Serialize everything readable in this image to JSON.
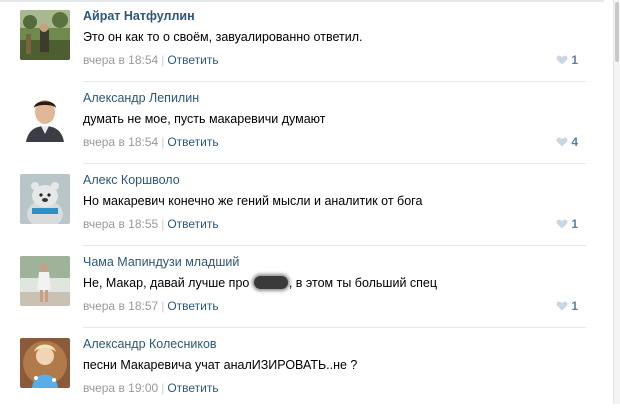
{
  "comments": [
    {
      "author": "Айрат Натфуллин",
      "text": "Это он как то о своём, завуалированно ответил.",
      "time": "вчера в 18:54",
      "reply": "Ответить",
      "likes": "1"
    },
    {
      "author": "Александр Лепилин",
      "text": "думать не мое, пусть макаревичи думают",
      "time": "вчера в 18:54",
      "reply": "Ответить",
      "likes": "4"
    },
    {
      "author": "Алекс Коршволо",
      "text": "Но макаревич конечно же гений мысли и аналитик от бога",
      "time": "вчера в 18:55",
      "reply": "Ответить",
      "likes": "1"
    },
    {
      "author": "Чама Мапиндузи младший",
      "text_before": "Не, Макар, давай лучше про",
      "text_after": ", в этом ты больший спец",
      "time": "вчера в 18:57",
      "reply": "Ответить",
      "likes": "1"
    },
    {
      "author": "Александр Колесников",
      "text": "песни Макаревича учат аналИЗИРОВАТЬ..не ?",
      "time": "вчера в 19:00",
      "reply": "Ответить"
    }
  ],
  "icons": {
    "like": "heart-icon"
  },
  "colors": {
    "link": "#2b587a",
    "meta": "#999999",
    "like": "#5b7fa6"
  }
}
